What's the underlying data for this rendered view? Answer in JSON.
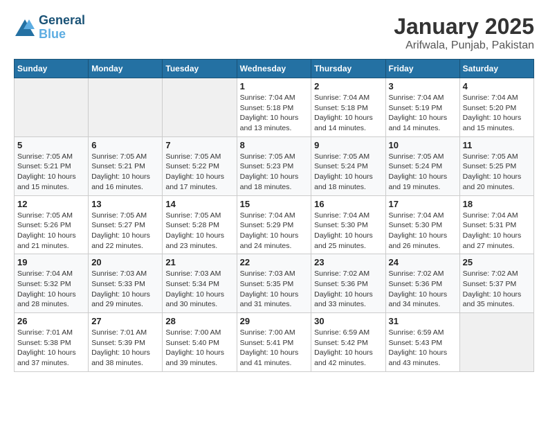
{
  "header": {
    "logo_line1": "General",
    "logo_line2": "Blue",
    "title": "January 2025",
    "subtitle": "Arifwala, Punjab, Pakistan"
  },
  "calendar": {
    "headers": [
      "Sunday",
      "Monday",
      "Tuesday",
      "Wednesday",
      "Thursday",
      "Friday",
      "Saturday"
    ],
    "weeks": [
      [
        {
          "day": "",
          "detail": ""
        },
        {
          "day": "",
          "detail": ""
        },
        {
          "day": "",
          "detail": ""
        },
        {
          "day": "1",
          "detail": "Sunrise: 7:04 AM\nSunset: 5:18 PM\nDaylight: 10 hours\nand 13 minutes."
        },
        {
          "day": "2",
          "detail": "Sunrise: 7:04 AM\nSunset: 5:18 PM\nDaylight: 10 hours\nand 14 minutes."
        },
        {
          "day": "3",
          "detail": "Sunrise: 7:04 AM\nSunset: 5:19 PM\nDaylight: 10 hours\nand 14 minutes."
        },
        {
          "day": "4",
          "detail": "Sunrise: 7:04 AM\nSunset: 5:20 PM\nDaylight: 10 hours\nand 15 minutes."
        }
      ],
      [
        {
          "day": "5",
          "detail": "Sunrise: 7:05 AM\nSunset: 5:21 PM\nDaylight: 10 hours\nand 15 minutes."
        },
        {
          "day": "6",
          "detail": "Sunrise: 7:05 AM\nSunset: 5:21 PM\nDaylight: 10 hours\nand 16 minutes."
        },
        {
          "day": "7",
          "detail": "Sunrise: 7:05 AM\nSunset: 5:22 PM\nDaylight: 10 hours\nand 17 minutes."
        },
        {
          "day": "8",
          "detail": "Sunrise: 7:05 AM\nSunset: 5:23 PM\nDaylight: 10 hours\nand 18 minutes."
        },
        {
          "day": "9",
          "detail": "Sunrise: 7:05 AM\nSunset: 5:24 PM\nDaylight: 10 hours\nand 18 minutes."
        },
        {
          "day": "10",
          "detail": "Sunrise: 7:05 AM\nSunset: 5:24 PM\nDaylight: 10 hours\nand 19 minutes."
        },
        {
          "day": "11",
          "detail": "Sunrise: 7:05 AM\nSunset: 5:25 PM\nDaylight: 10 hours\nand 20 minutes."
        }
      ],
      [
        {
          "day": "12",
          "detail": "Sunrise: 7:05 AM\nSunset: 5:26 PM\nDaylight: 10 hours\nand 21 minutes."
        },
        {
          "day": "13",
          "detail": "Sunrise: 7:05 AM\nSunset: 5:27 PM\nDaylight: 10 hours\nand 22 minutes."
        },
        {
          "day": "14",
          "detail": "Sunrise: 7:05 AM\nSunset: 5:28 PM\nDaylight: 10 hours\nand 23 minutes."
        },
        {
          "day": "15",
          "detail": "Sunrise: 7:04 AM\nSunset: 5:29 PM\nDaylight: 10 hours\nand 24 minutes."
        },
        {
          "day": "16",
          "detail": "Sunrise: 7:04 AM\nSunset: 5:30 PM\nDaylight: 10 hours\nand 25 minutes."
        },
        {
          "day": "17",
          "detail": "Sunrise: 7:04 AM\nSunset: 5:30 PM\nDaylight: 10 hours\nand 26 minutes."
        },
        {
          "day": "18",
          "detail": "Sunrise: 7:04 AM\nSunset: 5:31 PM\nDaylight: 10 hours\nand 27 minutes."
        }
      ],
      [
        {
          "day": "19",
          "detail": "Sunrise: 7:04 AM\nSunset: 5:32 PM\nDaylight: 10 hours\nand 28 minutes."
        },
        {
          "day": "20",
          "detail": "Sunrise: 7:03 AM\nSunset: 5:33 PM\nDaylight: 10 hours\nand 29 minutes."
        },
        {
          "day": "21",
          "detail": "Sunrise: 7:03 AM\nSunset: 5:34 PM\nDaylight: 10 hours\nand 30 minutes."
        },
        {
          "day": "22",
          "detail": "Sunrise: 7:03 AM\nSunset: 5:35 PM\nDaylight: 10 hours\nand 31 minutes."
        },
        {
          "day": "23",
          "detail": "Sunrise: 7:02 AM\nSunset: 5:36 PM\nDaylight: 10 hours\nand 33 minutes."
        },
        {
          "day": "24",
          "detail": "Sunrise: 7:02 AM\nSunset: 5:36 PM\nDaylight: 10 hours\nand 34 minutes."
        },
        {
          "day": "25",
          "detail": "Sunrise: 7:02 AM\nSunset: 5:37 PM\nDaylight: 10 hours\nand 35 minutes."
        }
      ],
      [
        {
          "day": "26",
          "detail": "Sunrise: 7:01 AM\nSunset: 5:38 PM\nDaylight: 10 hours\nand 37 minutes."
        },
        {
          "day": "27",
          "detail": "Sunrise: 7:01 AM\nSunset: 5:39 PM\nDaylight: 10 hours\nand 38 minutes."
        },
        {
          "day": "28",
          "detail": "Sunrise: 7:00 AM\nSunset: 5:40 PM\nDaylight: 10 hours\nand 39 minutes."
        },
        {
          "day": "29",
          "detail": "Sunrise: 7:00 AM\nSunset: 5:41 PM\nDaylight: 10 hours\nand 41 minutes."
        },
        {
          "day": "30",
          "detail": "Sunrise: 6:59 AM\nSunset: 5:42 PM\nDaylight: 10 hours\nand 42 minutes."
        },
        {
          "day": "31",
          "detail": "Sunrise: 6:59 AM\nSunset: 5:43 PM\nDaylight: 10 hours\nand 43 minutes."
        },
        {
          "day": "",
          "detail": ""
        }
      ]
    ]
  }
}
